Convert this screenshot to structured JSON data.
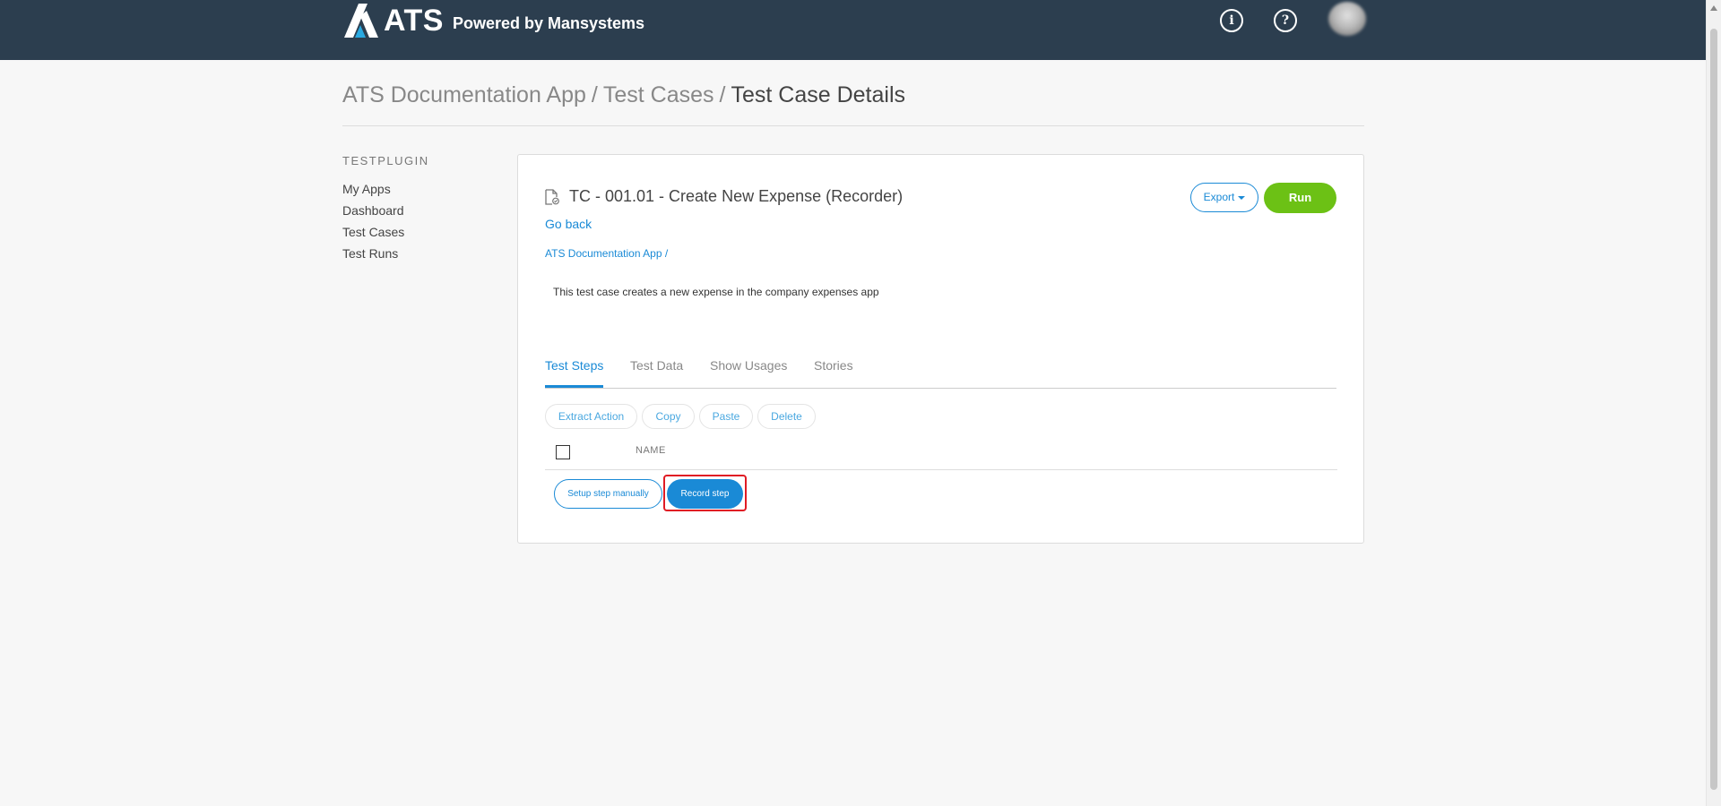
{
  "header": {
    "logo_text": "ATS",
    "logo_subtitle": "Powered by Mansystems",
    "info_icon_glyph": "i",
    "help_icon_glyph": "?",
    "colors": {
      "background": "#2c3e4f",
      "logo_accent": "#29a9e1"
    }
  },
  "breadcrumb": {
    "items": [
      "ATS Documentation App",
      "Test Cases"
    ],
    "separator": "/",
    "current": "Test Case Details"
  },
  "sidebar": {
    "title": "TESTPLUGIN",
    "items": [
      {
        "label": "My Apps"
      },
      {
        "label": "Dashboard"
      },
      {
        "label": "Test Cases"
      },
      {
        "label": "Test Runs"
      }
    ]
  },
  "test_case": {
    "title": "TC - 001.01 - Create New Expense (Recorder)",
    "go_back": "Go back",
    "app_crumb": "ATS Documentation App /",
    "description": "This test case creates a new expense in the company expenses app",
    "export_label": "Export",
    "run_label": "Run"
  },
  "tabs": [
    {
      "label": "Test Steps",
      "active": true
    },
    {
      "label": "Test Data",
      "active": false
    },
    {
      "label": "Show Usages",
      "active": false
    },
    {
      "label": "Stories",
      "active": false
    }
  ],
  "step_actions": {
    "extract_action": "Extract Action",
    "copy": "Copy",
    "paste": "Paste",
    "delete": "Delete"
  },
  "steps_table": {
    "columns": [
      "NAME"
    ],
    "rows": []
  },
  "step_buttons": {
    "setup_manually": "Setup step manually",
    "record_step": "Record step"
  },
  "colors": {
    "primary": "#1a8ad6",
    "run_green": "#6cc115",
    "highlight_red": "#e01b24"
  }
}
